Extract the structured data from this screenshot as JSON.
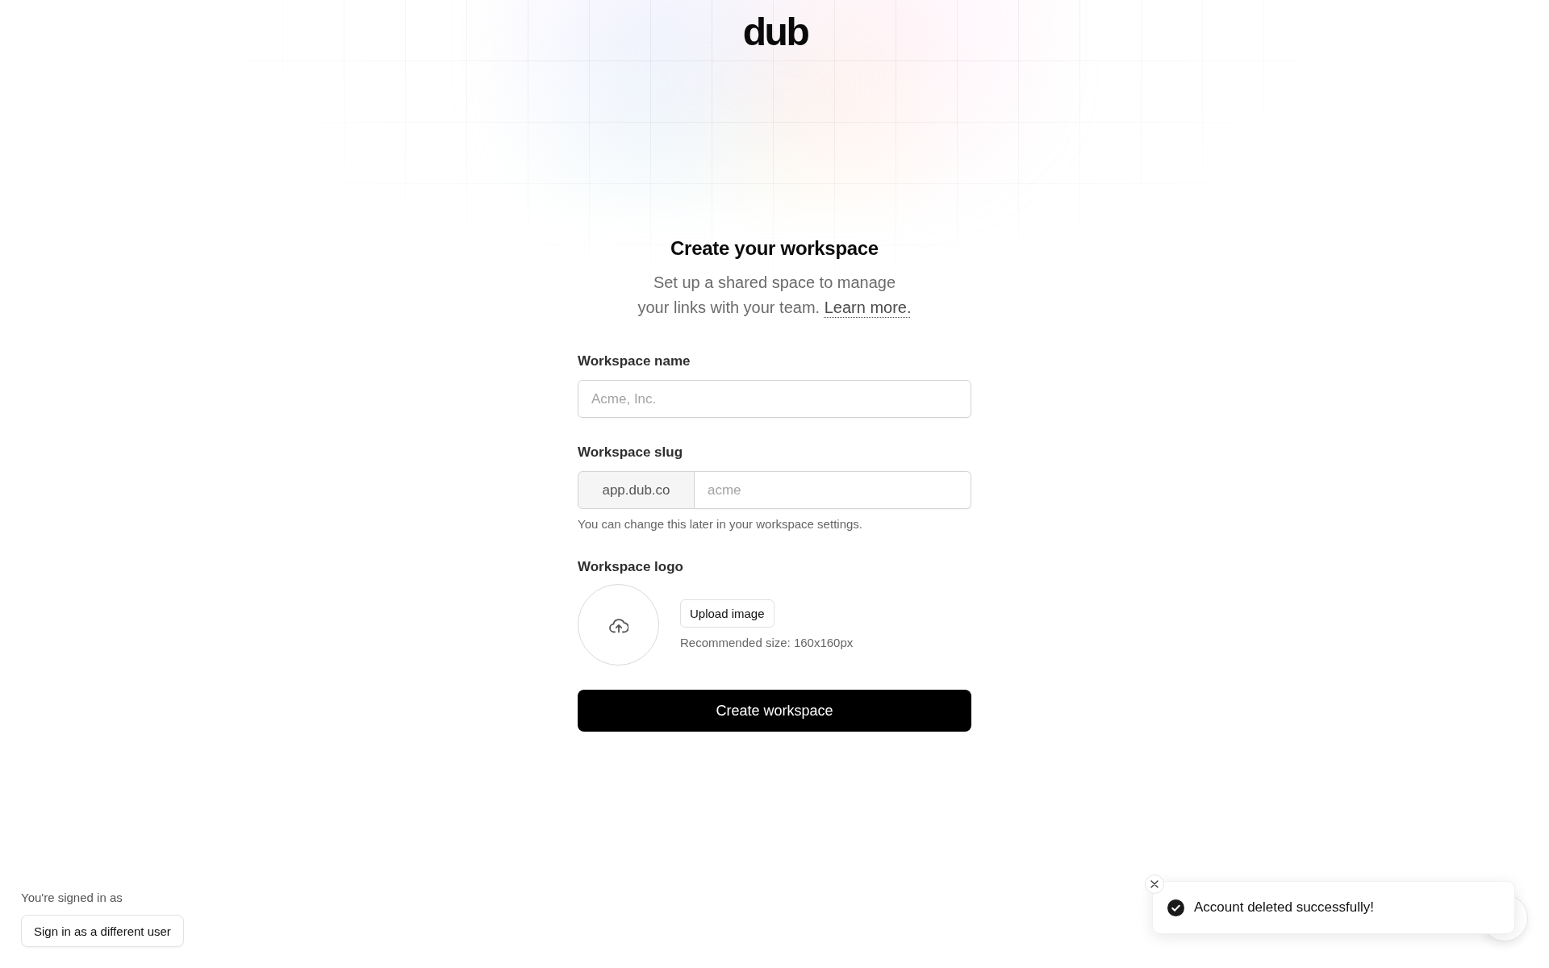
{
  "logo": {
    "text": "dub"
  },
  "header": {
    "title": "Create your workspace",
    "subtitle": "Set up a shared space to manage your links with your team.",
    "link": "Learn more."
  },
  "form": {
    "fields": [
      {
        "kind": "text",
        "label": "Workspace name",
        "placeholder": "Acme, Inc."
      },
      {
        "kind": "slug",
        "label": "Workspace slug",
        "prefix": "app.dub.co",
        "placeholder": "acme",
        "help": "You can change this later in your workspace settings."
      },
      {
        "kind": "logo",
        "label": "Workspace logo",
        "button": "Upload image",
        "help": "Recommended size: 160x160px"
      }
    ],
    "submit": "Create workspace"
  },
  "session": {
    "text": "You're signed in as",
    "button": "Sign in as a different user"
  },
  "toast": {
    "kind": "success",
    "message": "Account deleted successfully!"
  }
}
